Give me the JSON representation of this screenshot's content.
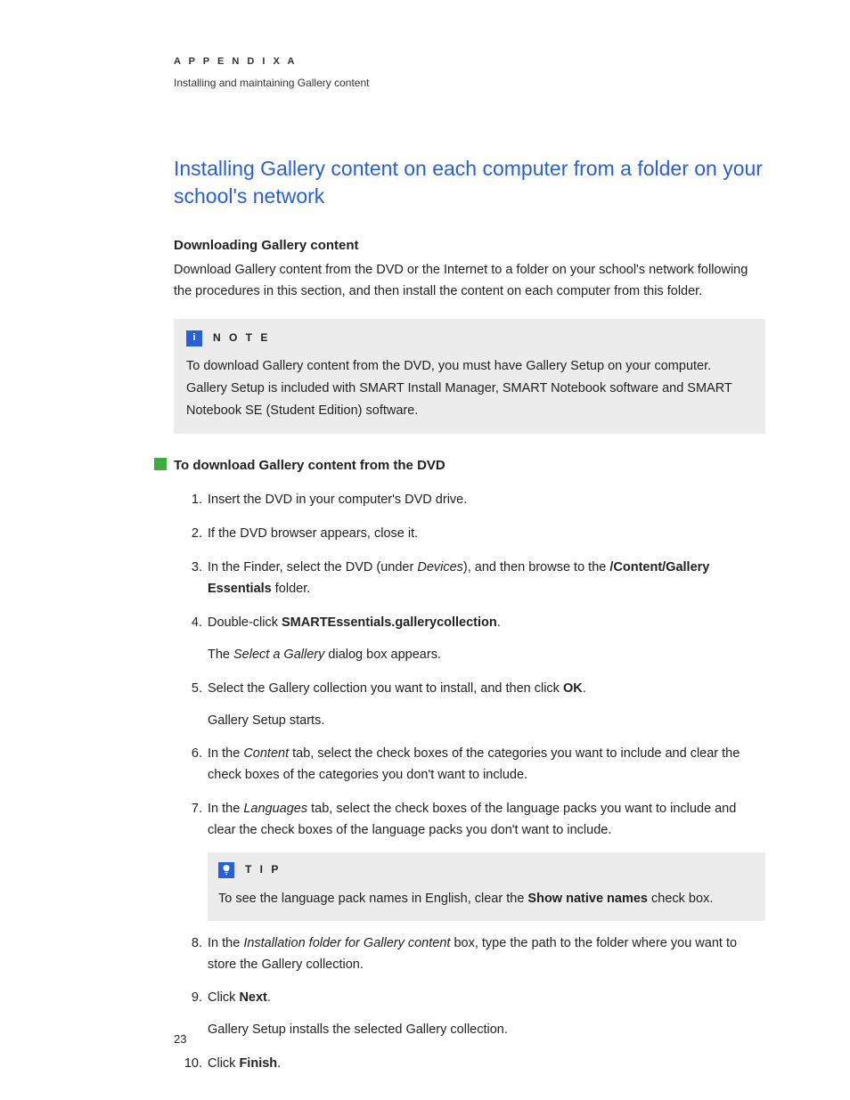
{
  "header": {
    "appendix": "A P P E N D I X   A",
    "subtitle": "Installing and maintaining Gallery content"
  },
  "title": "Installing Gallery content on each computer from a folder on your school's network",
  "subsection_title": "Downloading Gallery content",
  "intro_para": "Download Gallery content from the DVD or the Internet to a folder on your school's network following the procedures in this section, and then install the content on each computer from this folder.",
  "note": {
    "label": "N O T E",
    "icon_char": "i",
    "body": "To download Gallery content from the DVD, you must have Gallery Setup on your computer. Gallery Setup is included with SMART Install Manager, SMART Notebook software and SMART Notebook SE (Student Edition) software."
  },
  "procedure_title": "To download Gallery content from the DVD",
  "steps": {
    "s1": "Insert the DVD in your computer's DVD drive.",
    "s2": "If the DVD browser appears, close it.",
    "s3_a": "In the Finder, select the DVD (under ",
    "s3_i": "Devices",
    "s3_b": "), and then browse to the ",
    "s3_bold": "/Content/Gallery Essentials",
    "s3_c": " folder.",
    "s4_a": "Double-click ",
    "s4_bold": "SMARTEssentials.gallerycollection",
    "s4_b": ".",
    "s4_sub_a": "The ",
    "s4_sub_i": "Select a Gallery",
    "s4_sub_b": " dialog box appears.",
    "s5_a": "Select the Gallery collection you want to install, and then click ",
    "s5_bold": "OK",
    "s5_b": ".",
    "s5_sub": "Gallery Setup starts.",
    "s6_a": "In the ",
    "s6_i": "Content",
    "s6_b": " tab, select the check boxes of the categories you want to include and clear the check boxes of the categories you don't want to include.",
    "s7_a": "In the ",
    "s7_i": "Languages",
    "s7_b": " tab, select the check boxes of the language packs you want to include and clear the check boxes of the language packs you don't want to include.",
    "s8_a": "In the ",
    "s8_i": "Installation folder for Gallery content",
    "s8_b": " box, type the path to the folder where you want to store the Gallery collection.",
    "s9_a": "Click ",
    "s9_bold": "Next",
    "s9_b": ".",
    "s9_sub": "Gallery Setup installs the selected Gallery collection.",
    "s10_a": "Click ",
    "s10_bold": "Finish",
    "s10_b": "."
  },
  "tip": {
    "label": "T I P",
    "body_a": "To see the language pack names in English, clear the ",
    "body_bold": "Show native names",
    "body_b": " check box."
  },
  "page_number": "23"
}
